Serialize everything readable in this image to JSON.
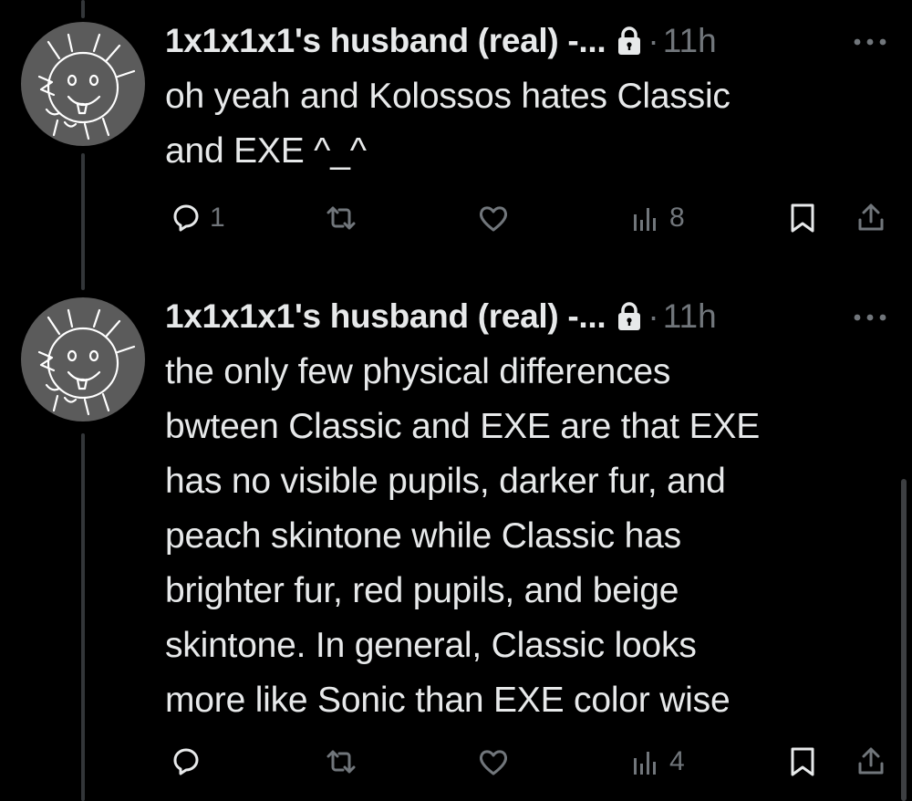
{
  "tweets": [
    {
      "display_name": "1x1x1x1's husband (real) -...",
      "separator": "·",
      "time": "11h",
      "text_lines": [
        "oh yeah and Kolossos hates Classic",
        "and EXE ^_^"
      ],
      "reply_count": "1",
      "views_count": "8"
    },
    {
      "display_name": "1x1x1x1's husband (real) -...",
      "separator": "·",
      "time": "11h",
      "text_lines": [
        "the only few physical differences",
        "bwteen Classic and EXE are that EXE",
        "has no visible pupils, darker fur, and",
        "peach skintone while Classic has",
        "brighter fur, red pupils, and beige",
        "skintone. In general, Classic looks",
        "more like Sonic than EXE color wise"
      ],
      "reply_count": "",
      "views_count": "4"
    }
  ],
  "icons": {
    "lock": "lock-icon",
    "more": "more-icon",
    "reply": "reply-icon",
    "retweet": "retweet-icon",
    "like": "like-icon",
    "views": "views-icon",
    "bookmark": "bookmark-icon",
    "share": "share-icon"
  },
  "colors": {
    "background": "#000000",
    "text": "#e7e9ea",
    "secondary": "#71767b",
    "thread_line": "#333639"
  }
}
